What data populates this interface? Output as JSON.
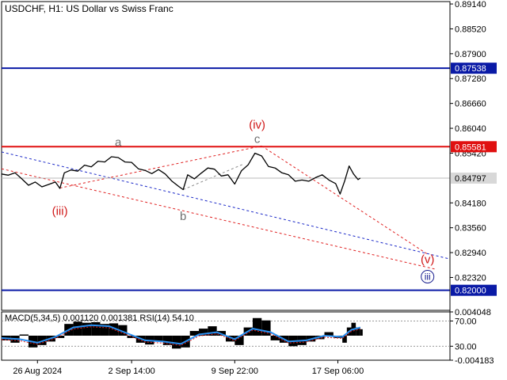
{
  "title": "USDCHF, H1:  US Dollar vs Swiss Franc",
  "indicator_title": "MACD(5,34,5) 0.001120 0.001381 RSI(14) 54.10",
  "colors": {
    "price": "#000000",
    "blue_level": "#0a1aa6",
    "red_level": "#e01010",
    "red_dashed": "#e02020",
    "blue_dashed": "#1a28c8",
    "wave_label_red": "#d01818",
    "wave_label_blue": "#1a2090",
    "wave_label_gray": "#707070",
    "macd_line": "#2a8ff0"
  },
  "chart_data": {
    "type": "line",
    "symbol": "USDCHF",
    "timeframe": "H1",
    "ylim": [
      0.815,
      0.892
    ],
    "y_ticks": [
      "0.89140",
      "0.88520",
      "0.87900",
      "0.87280",
      "0.86660",
      "0.86040",
      "0.85420",
      "0.84180",
      "0.83560",
      "0.82940",
      "0.82320"
    ],
    "x_ticks": [
      "26 Aug 2024",
      "2 Sep 14:00",
      "9 Sep 22:00",
      "17 Sep 06:00"
    ],
    "x_range": [
      0,
      100
    ],
    "x_tick_positions": [
      8,
      29,
      52,
      75
    ],
    "price_series": [
      [
        0,
        0.849
      ],
      [
        1.5,
        0.8487
      ],
      [
        3,
        0.8493
      ],
      [
        4.5,
        0.8478
      ],
      [
        6,
        0.8462
      ],
      [
        7.5,
        0.847
      ],
      [
        9,
        0.8458
      ],
      [
        10.5,
        0.8464
      ],
      [
        12,
        0.847
      ],
      [
        13,
        0.8454
      ],
      [
        14,
        0.8493
      ],
      [
        15.5,
        0.85
      ],
      [
        17,
        0.8497
      ],
      [
        18.5,
        0.8512
      ],
      [
        20,
        0.8508
      ],
      [
        21.5,
        0.8522
      ],
      [
        23,
        0.852
      ],
      [
        24.5,
        0.8533
      ],
      [
        26,
        0.8531
      ],
      [
        27.5,
        0.852
      ],
      [
        29,
        0.8519
      ],
      [
        30.5,
        0.8503
      ],
      [
        32,
        0.8499
      ],
      [
        33.5,
        0.8491
      ],
      [
        35,
        0.8501
      ],
      [
        36.5,
        0.849
      ],
      [
        38,
        0.8472
      ],
      [
        39.5,
        0.8459
      ],
      [
        40.5,
        0.8451
      ],
      [
        41.5,
        0.8488
      ],
      [
        43,
        0.8478
      ],
      [
        44.5,
        0.8492
      ],
      [
        46,
        0.8505
      ],
      [
        47.5,
        0.8502
      ],
      [
        49,
        0.8485
      ],
      [
        50.5,
        0.8488
      ],
      [
        52,
        0.8465
      ],
      [
        53.5,
        0.8498
      ],
      [
        55,
        0.8513
      ],
      [
        56.5,
        0.8542
      ],
      [
        58,
        0.8535
      ],
      [
        59.5,
        0.8509
      ],
      [
        61,
        0.8505
      ],
      [
        62.5,
        0.8493
      ],
      [
        64,
        0.8488
      ],
      [
        65.5,
        0.8472
      ],
      [
        67,
        0.8475
      ],
      [
        68.5,
        0.8472
      ],
      [
        70,
        0.8481
      ],
      [
        71.5,
        0.8488
      ],
      [
        73,
        0.8475
      ],
      [
        74.5,
        0.8466
      ],
      [
        75.5,
        0.844
      ],
      [
        76.5,
        0.8472
      ],
      [
        77.5,
        0.851
      ],
      [
        78.5,
        0.849
      ],
      [
        79.5,
        0.8476
      ],
      [
        80,
        0.848
      ]
    ],
    "levels": [
      {
        "value": 0.87538,
        "label": "0.87538",
        "color": "blue"
      },
      {
        "value": 0.85581,
        "label": "0.85581",
        "color": "red"
      },
      {
        "value": 0.84797,
        "label": "0.84797",
        "color": "gray"
      },
      {
        "value": 0.82,
        "label": "0.82000",
        "color": "blue"
      }
    ],
    "trend_lines": [
      {
        "style": "red-dashed",
        "points": [
          [
            0,
            0.8503
          ],
          [
            97,
            0.8252
          ]
        ]
      },
      {
        "style": "blue-dashed",
        "points": [
          [
            0,
            0.8545
          ],
          [
            100,
            0.8278
          ]
        ]
      },
      {
        "style": "red-dashed",
        "points": [
          [
            13,
            0.8455
          ],
          [
            58,
            0.856
          ]
        ]
      },
      {
        "style": "red-dashed",
        "points": [
          [
            58,
            0.856
          ],
          [
            95,
            0.829
          ]
        ]
      },
      {
        "style": "gray-dashed",
        "points": [
          [
            40.5,
            0.8451
          ],
          [
            54,
            0.8515
          ]
        ]
      }
    ],
    "wave_labels": [
      {
        "text": "(iii)",
        "x": 13,
        "y": 0.8388,
        "color": "red",
        "circle": false
      },
      {
        "text": "a",
        "x": 26,
        "y": 0.856,
        "color": "gray",
        "circle": false
      },
      {
        "text": "b",
        "x": 40.5,
        "y": 0.8375,
        "color": "gray",
        "circle": false
      },
      {
        "text": "(iv)",
        "x": 57,
        "y": 0.8603,
        "color": "red",
        "circle": false
      },
      {
        "text": "c",
        "x": 57,
        "y": 0.8568,
        "color": "gray",
        "circle": false
      },
      {
        "text": "(v)",
        "x": 95,
        "y": 0.8267,
        "color": "red",
        "circle": false
      },
      {
        "text": "iii",
        "x": 95,
        "y": 0.8226,
        "color": "blue",
        "circle": true
      }
    ],
    "indicator": {
      "ylim": [
        -0.004183,
        0.004048
      ],
      "y_ticks": [
        "0.004048",
        "70.00",
        "30.00",
        "-0.004183"
      ],
      "macd_hist": [
        [
          0,
          -0.0008
        ],
        [
          2,
          -0.0012
        ],
        [
          4,
          0.0002
        ],
        [
          6,
          -0.002
        ],
        [
          8,
          -0.0016
        ],
        [
          10,
          -0.001
        ],
        [
          12,
          -0.0004
        ],
        [
          14,
          0.002
        ],
        [
          16,
          0.0024
        ],
        [
          18,
          0.0022
        ],
        [
          20,
          0.0023
        ],
        [
          22,
          0.002
        ],
        [
          24,
          0.0021
        ],
        [
          26,
          0.0018
        ],
        [
          28,
          -0.0004
        ],
        [
          30,
          -0.0012
        ],
        [
          32,
          -0.0015
        ],
        [
          34,
          -0.001
        ],
        [
          36,
          -0.0016
        ],
        [
          38,
          -0.0022
        ],
        [
          40,
          -0.002
        ],
        [
          42,
          0.0008
        ],
        [
          44,
          0.0012
        ],
        [
          46,
          0.0016
        ],
        [
          48,
          0.0008
        ],
        [
          50,
          -0.001
        ],
        [
          52,
          -0.0016
        ],
        [
          54,
          0.0014
        ],
        [
          56,
          0.003
        ],
        [
          58,
          0.0026
        ],
        [
          60,
          -0.0008
        ],
        [
          62,
          -0.0012
        ],
        [
          64,
          -0.0018
        ],
        [
          66,
          -0.0016
        ],
        [
          68,
          -0.001
        ],
        [
          70,
          -0.0006
        ],
        [
          72,
          0.0006
        ],
        [
          74,
          -0.0004
        ],
        [
          76,
          -0.0012
        ],
        [
          77,
          0.0014
        ],
        [
          78,
          0.0022
        ],
        [
          79,
          0.0014
        ],
        [
          80,
          0.0011
        ]
      ],
      "macd_signal": [
        [
          0,
          -0.0004
        ],
        [
          4,
          -0.0006
        ],
        [
          8,
          -0.0012
        ],
        [
          12,
          -0.0002
        ],
        [
          16,
          0.0014
        ],
        [
          20,
          0.0018
        ],
        [
          24,
          0.0016
        ],
        [
          28,
          0.0004
        ],
        [
          32,
          -0.0008
        ],
        [
          36,
          -0.001
        ],
        [
          40,
          -0.0014
        ],
        [
          44,
          0.0002
        ],
        [
          48,
          0.0006
        ],
        [
          52,
          -0.0006
        ],
        [
          56,
          0.0012
        ],
        [
          60,
          0.0006
        ],
        [
          64,
          -0.001
        ],
        [
          68,
          -0.0008
        ],
        [
          72,
          0.0
        ],
        [
          76,
          -0.0002
        ],
        [
          78,
          0.001
        ],
        [
          80,
          0.0014
        ]
      ]
    }
  }
}
